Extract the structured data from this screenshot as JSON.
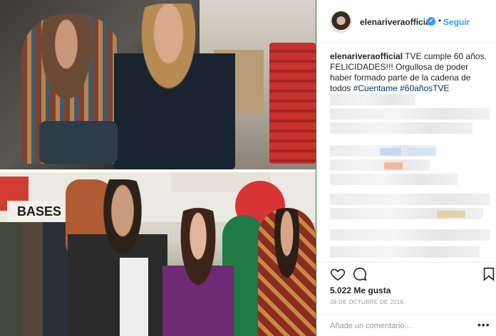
{
  "post": {
    "author": {
      "username": "elenariveraofficial",
      "verified": true,
      "follow_label": "Seguir",
      "separator": "•"
    },
    "caption": {
      "username": "elenariveraofficial",
      "text": " TVE cumple 60 años. FELICIDADES!!! Orgullosa de poder haber formado parte de la cadena de todos ",
      "hashtag_1": "#Cuentame",
      "hashtag_2": "#60añosTVE"
    },
    "photo_sign_text": "BASES",
    "actions": {
      "like_icon": "heart-icon",
      "comment_icon": "comment-icon",
      "save_icon": "bookmark-icon"
    },
    "likes_text": "5.022 Me gusta",
    "date_text": "28 DE OCTUBRE DE 2016",
    "comment": {
      "placeholder": "Añade un comentario...",
      "more_icon": "more-dots-icon",
      "more_text": "•••"
    },
    "colors": {
      "link_blue": "#3897f0",
      "hashtag_blue": "#003569",
      "verified_blue": "#3897f0",
      "muted_gray": "#999999"
    }
  }
}
